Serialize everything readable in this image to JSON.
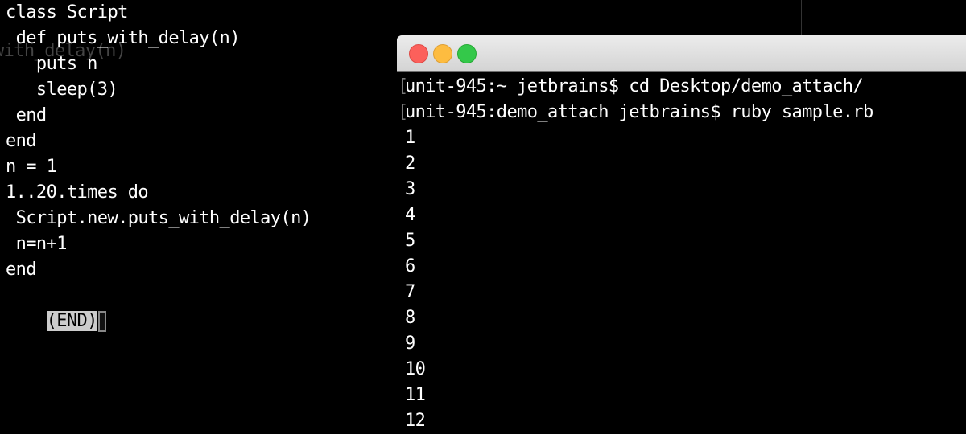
{
  "editor": {
    "ghost_text": "with_delay(n)",
    "lines": [
      "class Script",
      " def puts_with_delay(n)",
      "   puts n",
      "   sleep(3)",
      " end",
      "end",
      "n = 1",
      "1..20.times do",
      " Script.new.puts_with_delay(n)",
      " n=n+1",
      "end"
    ],
    "end_marker": "(END)"
  },
  "terminal": {
    "window_buttons": [
      "close",
      "minimize",
      "maximize"
    ],
    "commands": [
      "unit-945:~ jetbrains$ cd Desktop/demo_attach/",
      "unit-945:demo_attach jetbrains$ ruby sample.rb"
    ],
    "output": [
      "1",
      "2",
      "3",
      "4",
      "5",
      "6",
      "7",
      "8",
      "9",
      "10",
      "11",
      "12"
    ]
  }
}
